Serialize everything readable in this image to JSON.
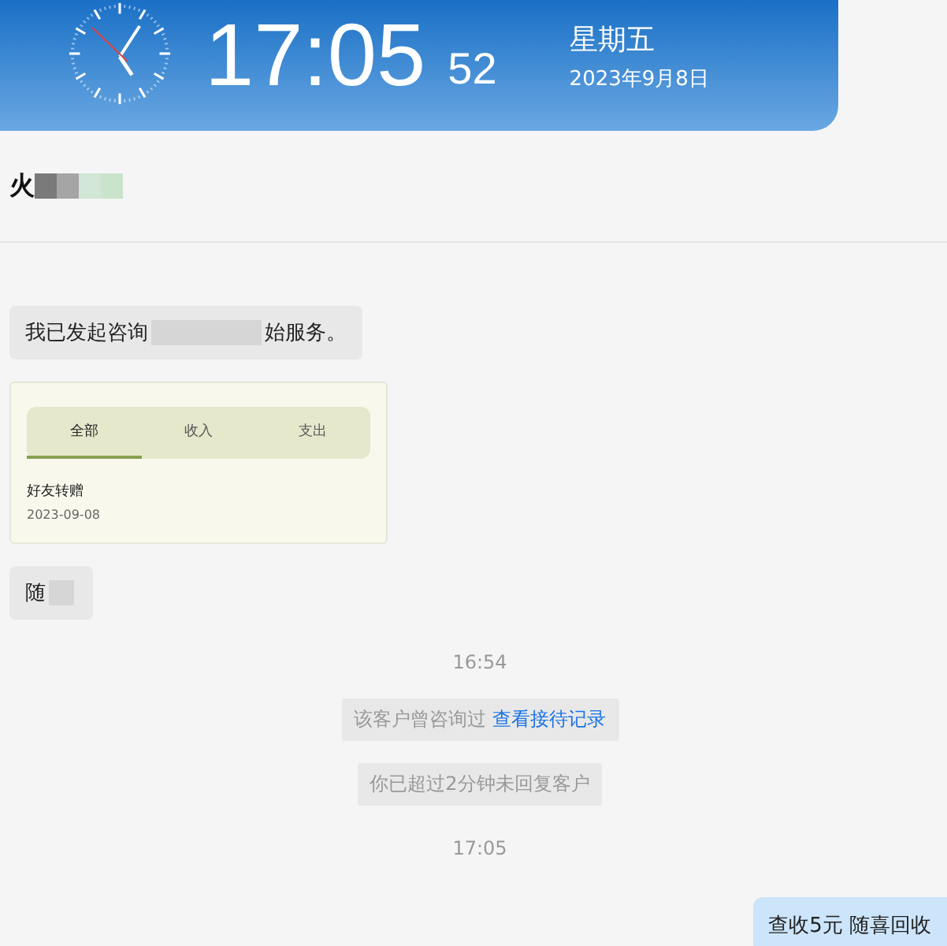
{
  "header": {
    "time": "17:05",
    "seconds": "52",
    "weekday": "星期五",
    "date": "2023年9月8日"
  },
  "contact": {
    "name": "火"
  },
  "messages": [
    {
      "kind": "incoming",
      "parts": [
        "我已发起咨询",
        "始服务。"
      ]
    },
    {
      "kind": "card",
      "tabs": [
        {
          "label": "全部",
          "selected": true
        },
        {
          "label": "收入",
          "selected": false
        },
        {
          "label": "支出",
          "selected": false
        }
      ],
      "title": "好友转赠",
      "date": "2023-09-08"
    },
    {
      "kind": "incoming",
      "parts": [
        "随"
      ]
    },
    {
      "kind": "time",
      "text": "16:54"
    },
    {
      "kind": "notice",
      "text": "该客户曾咨询过",
      "link": "查看接待记录"
    },
    {
      "kind": "notice",
      "text": "你已超过2分钟未回复客户"
    },
    {
      "kind": "time",
      "text": "17:05"
    },
    {
      "kind": "outgoing",
      "parts": [
        "查收5元 随喜回收"
      ]
    }
  ]
}
